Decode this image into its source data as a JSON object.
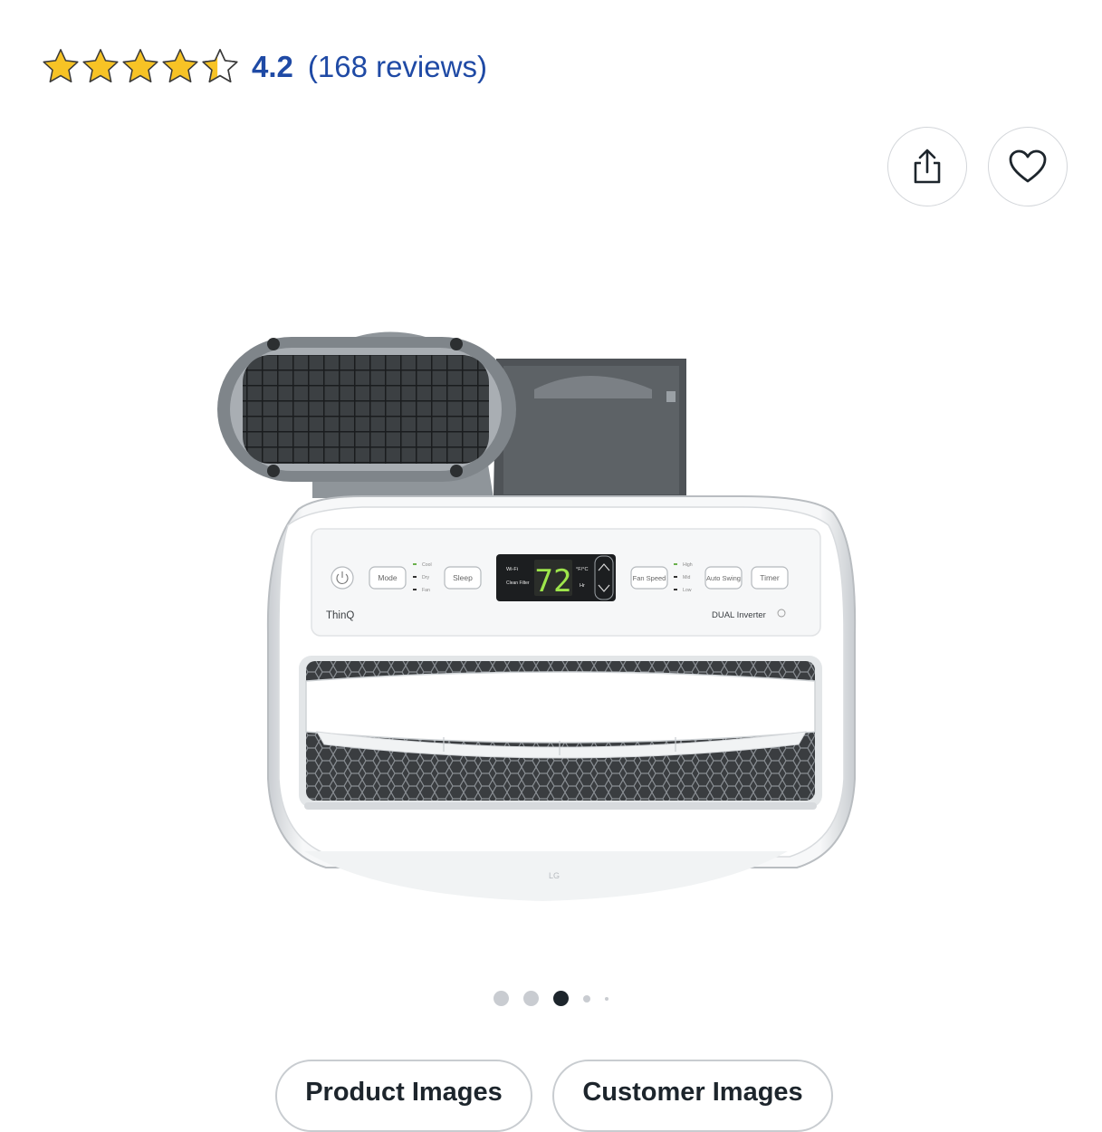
{
  "header": {
    "cut_title": "‒‒‒ ‒ ‒‒‒‒ ‒‒‒‒ ‒‒‒‒‒‒"
  },
  "rating": {
    "value": "4.2",
    "count_label": "(168 reviews)",
    "stars_filled": 4.2,
    "stars_total": 5
  },
  "actions": {
    "share_icon": "share-icon",
    "favorite_icon": "heart-icon"
  },
  "carousel": {
    "image_count": 5,
    "active_index": 2
  },
  "product_display": {
    "temperature": "72",
    "wifi": "Wi-Fi",
    "clean_filter": "Clean Filter",
    "unit": "°F/°C",
    "hr": "Hr",
    "mode": "Mode",
    "sleep": "Sleep",
    "fan_speed": "Fan Speed",
    "auto_swing": "Auto Swing",
    "timer": "Timer",
    "thinq": "ThinQ",
    "dual_inverter": "DUAL Inverter",
    "cool": "Cool",
    "dry": "Dry",
    "fan": "Fan",
    "high": "High",
    "mid": "Mid",
    "low": "Low",
    "lg": "LG"
  },
  "tabs": [
    {
      "label": "Product Images"
    },
    {
      "label": "Customer Images"
    }
  ],
  "colors": {
    "star": "#f7c325",
    "link": "#1f4aa5",
    "dot_active": "#1d252c",
    "dot_inactive": "#c9ccd1"
  }
}
